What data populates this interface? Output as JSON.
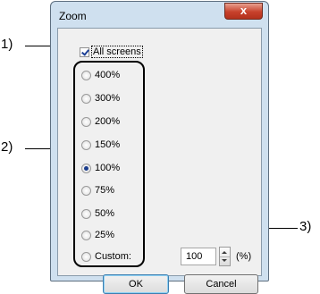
{
  "window": {
    "title": "Zoom",
    "close_glyph": "x"
  },
  "all_screens": {
    "label": "All screens",
    "checked": true
  },
  "zoom_options": [
    {
      "label": "400%",
      "checked": false
    },
    {
      "label": "300%",
      "checked": false
    },
    {
      "label": "200%",
      "checked": false
    },
    {
      "label": "150%",
      "checked": false
    },
    {
      "label": "100%",
      "checked": true
    },
    {
      "label": "75%",
      "checked": false
    },
    {
      "label": "50%",
      "checked": false
    },
    {
      "label": "25%",
      "checked": false
    },
    {
      "label": "Custom:",
      "checked": false
    }
  ],
  "custom": {
    "value": "100",
    "unit": "(%)"
  },
  "buttons": {
    "ok": "OK",
    "cancel": "Cancel"
  },
  "callouts": {
    "one": "1)",
    "two": "2)",
    "three": "3)"
  },
  "icons": {
    "close": "close-icon",
    "spin_up": "chevron-up-icon",
    "spin_down": "chevron-down-icon"
  }
}
